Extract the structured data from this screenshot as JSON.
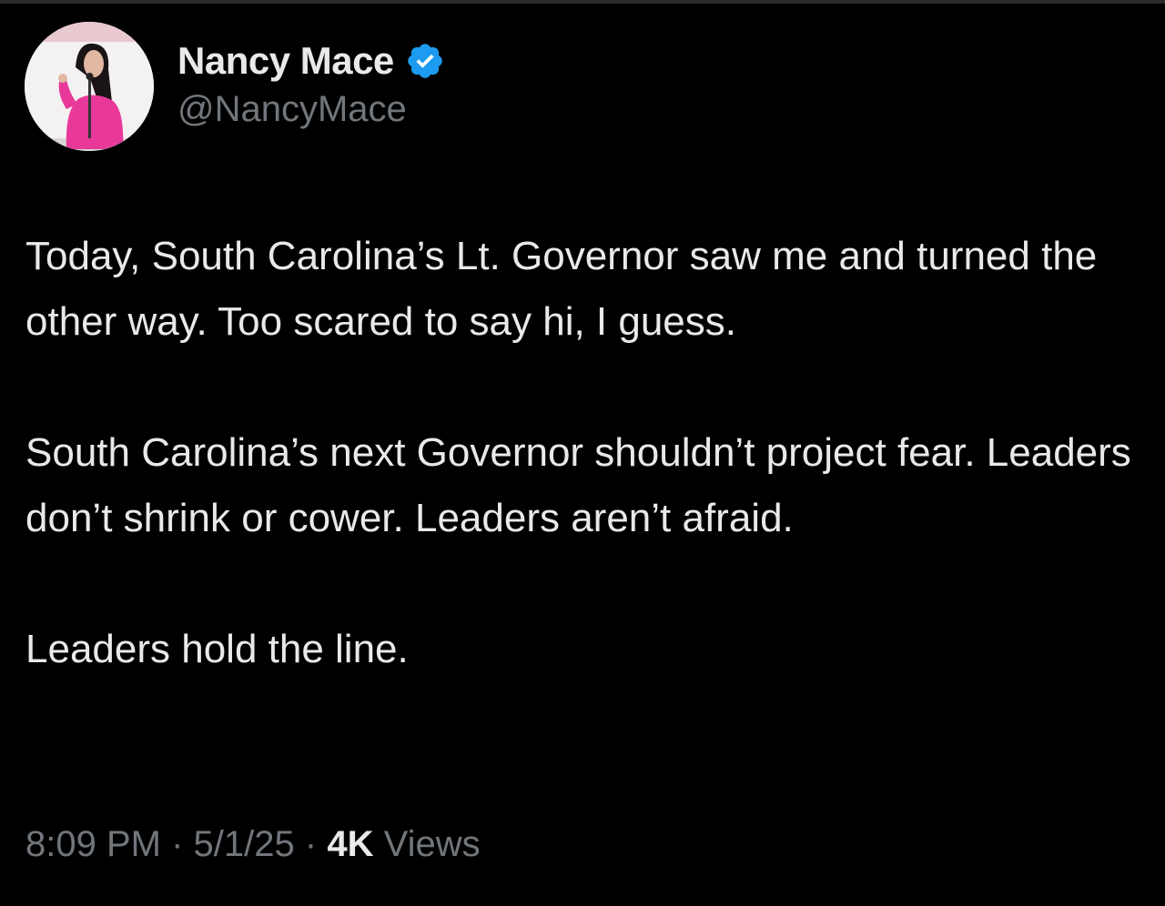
{
  "author": {
    "display_name": "Nancy Mace",
    "handle": "@NancyMace",
    "verified": true,
    "verified_icon": "verified-badge-icon",
    "verified_color": "#1d9bf0"
  },
  "tweet": {
    "paragraphs": [
      "Today, South Carolina’s Lt. Governor saw me and turned the other way. Too scared to say hi, I guess.",
      "South Carolina’s next Governor shouldn’t project fear. Leaders don’t shrink or cower. Leaders aren’t afraid.",
      "Leaders hold the line."
    ]
  },
  "meta": {
    "time": "8:09 PM",
    "separator": "·",
    "date": "5/1/25",
    "views_count": "4K",
    "views_label": "Views"
  },
  "colors": {
    "background": "#000000",
    "primary_text": "#e7e9ea",
    "secondary_text": "#71767b",
    "accent": "#1d9bf0"
  }
}
